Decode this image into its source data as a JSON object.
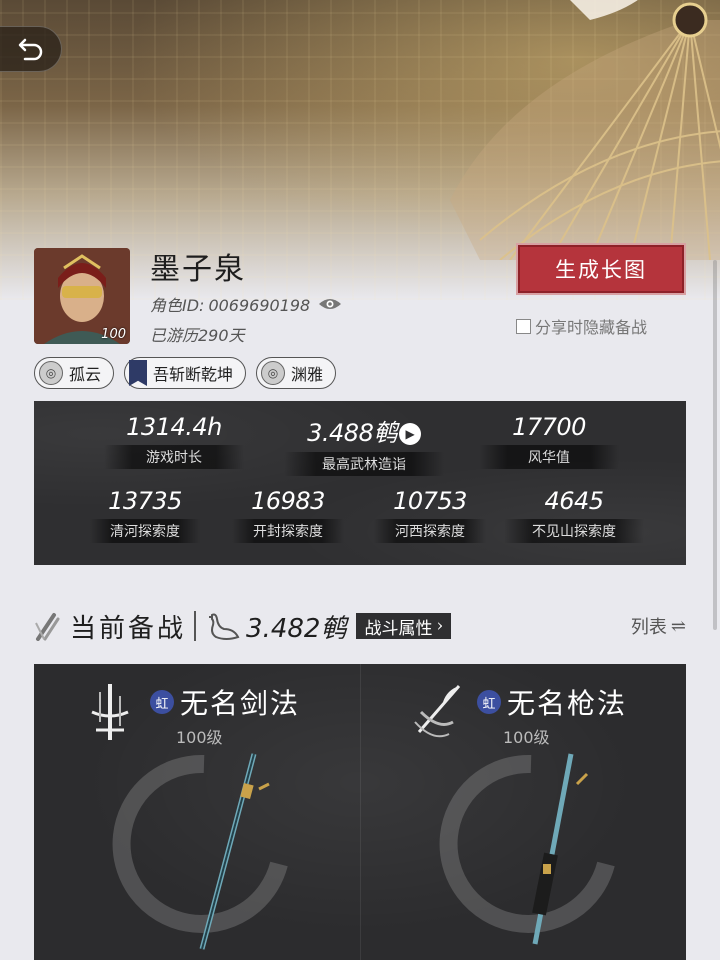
{
  "profile": {
    "name": "墨子泉",
    "role_id_label": "角色ID:",
    "role_id": "0069690198",
    "days": "已游历290天",
    "avatar_level": "100",
    "generate_button": "生成长图",
    "hide_on_share": "分享时隐藏备战"
  },
  "tags": [
    {
      "label": "孤云",
      "icon": "circle-emblem-icon"
    },
    {
      "label": "吾斩断乾坤",
      "icon": "banner-icon"
    },
    {
      "label": "渊雅",
      "icon": "circle-emblem-icon"
    }
  ],
  "stats": {
    "row1": [
      {
        "value": "1314.4h",
        "label": "游戏时长"
      },
      {
        "value": "3.488鹌",
        "label": "最高武林造诣"
      },
      {
        "value": "17700",
        "label": "风华值"
      }
    ],
    "row2": [
      {
        "value": "13735",
        "label": "清河探索度"
      },
      {
        "value": "16983",
        "label": "开封探索度"
      },
      {
        "value": "10753",
        "label": "河西探索度"
      },
      {
        "value": "4645",
        "label": "不见山探索度"
      }
    ]
  },
  "section": {
    "title": "当前备战",
    "score": "3.482鹌",
    "attr_button": "战斗属性",
    "list_toggle": "列表"
  },
  "weapons": [
    {
      "badge": "虹",
      "name": "无名剑法",
      "level": "100级",
      "icon": "sword-icon"
    },
    {
      "badge": "虹",
      "name": "无名枪法",
      "level": "100级",
      "icon": "spear-icon"
    }
  ],
  "colors": {
    "accent_red": "#b5343c",
    "panel_dark": "#2f2f31",
    "badge_blue": "#3c4fa0"
  }
}
